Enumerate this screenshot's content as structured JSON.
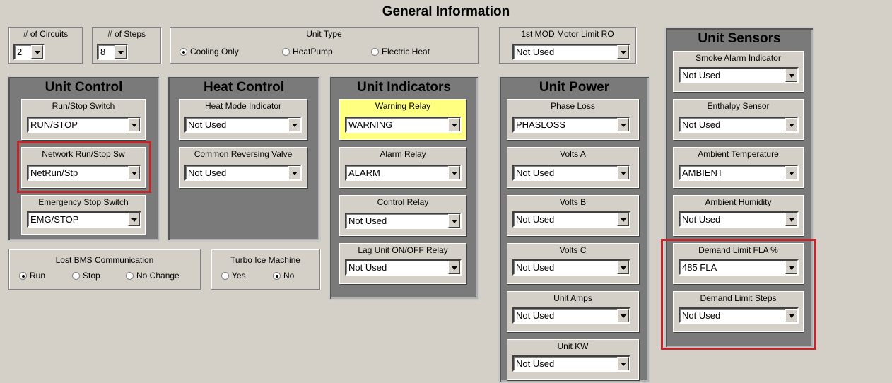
{
  "title": "General Information",
  "circuits": {
    "label": "# of Circuits",
    "value": "2"
  },
  "steps": {
    "label": "# of Steps",
    "value": "8"
  },
  "unit_type": {
    "label": "Unit Type",
    "options": [
      "Cooling Only",
      "HeatPump",
      "Electric Heat"
    ],
    "selected": "Cooling Only"
  },
  "mod_motor": {
    "label": "1st MOD Motor Limit RO",
    "value": "Not Used"
  },
  "unit_control": {
    "title": "Unit Control",
    "items": [
      {
        "label": "Run/Stop Switch",
        "value": "RUN/STOP"
      },
      {
        "label": "Network Run/Stop Sw",
        "value": "NetRun/Stp"
      },
      {
        "label": "Emergency Stop Switch",
        "value": "EMG/STOP"
      }
    ]
  },
  "heat_control": {
    "title": "Heat Control",
    "items": [
      {
        "label": "Heat Mode Indicator",
        "value": "Not Used"
      },
      {
        "label": "Common Reversing Valve",
        "value": "Not Used"
      }
    ]
  },
  "unit_indicators": {
    "title": "Unit Indicators",
    "items": [
      {
        "label": "Warning Relay",
        "value": "WARNING"
      },
      {
        "label": "Alarm Relay",
        "value": "ALARM"
      },
      {
        "label": "Control Relay",
        "value": "Not Used"
      },
      {
        "label": "Lag Unit ON/OFF Relay",
        "value": "Not Used"
      }
    ]
  },
  "unit_power": {
    "title": "Unit Power",
    "items": [
      {
        "label": "Phase Loss",
        "value": "PHASLOSS"
      },
      {
        "label": "Volts A",
        "value": "Not Used"
      },
      {
        "label": "Volts B",
        "value": "Not Used"
      },
      {
        "label": "Volts C",
        "value": "Not Used"
      },
      {
        "label": "Unit Amps",
        "value": "Not Used"
      },
      {
        "label": "Unit KW",
        "value": "Not Used"
      }
    ]
  },
  "unit_sensors": {
    "title": "Unit Sensors",
    "items": [
      {
        "label": "Smoke Alarm Indicator",
        "value": "Not Used"
      },
      {
        "label": "Enthalpy Sensor",
        "value": "Not Used"
      },
      {
        "label": "Ambient Temperature",
        "value": "AMBIENT"
      },
      {
        "label": "Ambient Humidity",
        "value": "Not Used"
      },
      {
        "label": "Demand Limit FLA %",
        "value": "485 FLA"
      },
      {
        "label": "Demand Limit Steps",
        "value": "Not Used"
      }
    ]
  },
  "lost_bms": {
    "label": "Lost BMS Communication",
    "options": [
      "Run",
      "Stop",
      "No Change"
    ],
    "selected": "Run"
  },
  "turbo_ice": {
    "label": "Turbo Ice Machine",
    "options": [
      "Yes",
      "No"
    ],
    "selected": "No"
  },
  "colors": {
    "panel": "#7a7a7a",
    "background": "#d4d0c8",
    "highlight": "#c4252a",
    "warning_bg": "#ffff80"
  }
}
